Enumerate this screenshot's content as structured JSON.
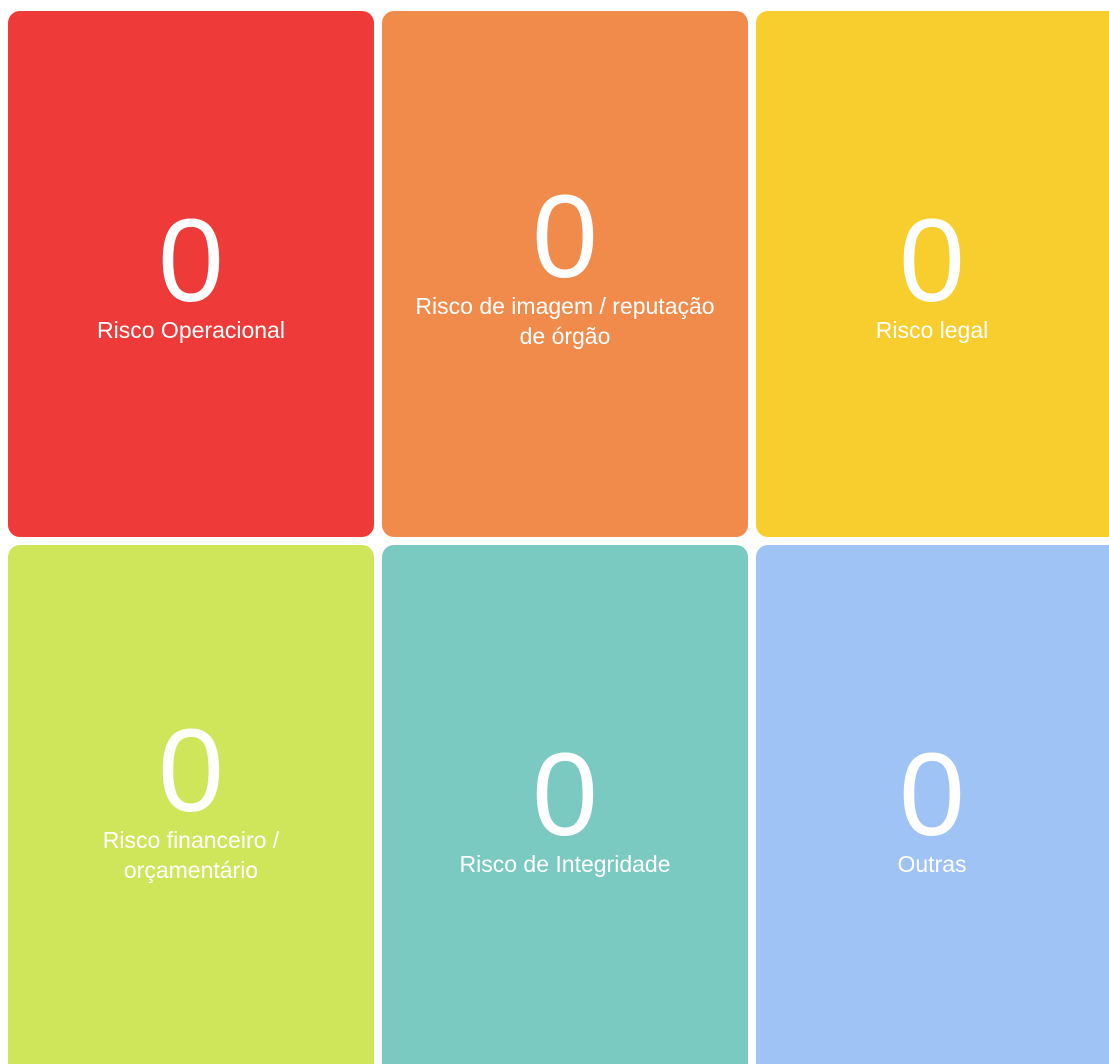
{
  "cards": [
    {
      "count": "0",
      "label": "Risco Operacional",
      "color": "#ee3a38"
    },
    {
      "count": "0",
      "label": "Risco de imagem / reputação de órgão",
      "color": "#f08b4b"
    },
    {
      "count": "0",
      "label": "Risco legal",
      "color": "#f7ce2d"
    },
    {
      "count": "0",
      "label": "Risco financeiro / orçamentário",
      "color": "#cfe65b"
    },
    {
      "count": "0",
      "label": "Risco de Integridade",
      "color": "#7bcac1"
    },
    {
      "count": "0",
      "label": "Outras",
      "color": "#a0c3f5"
    }
  ]
}
